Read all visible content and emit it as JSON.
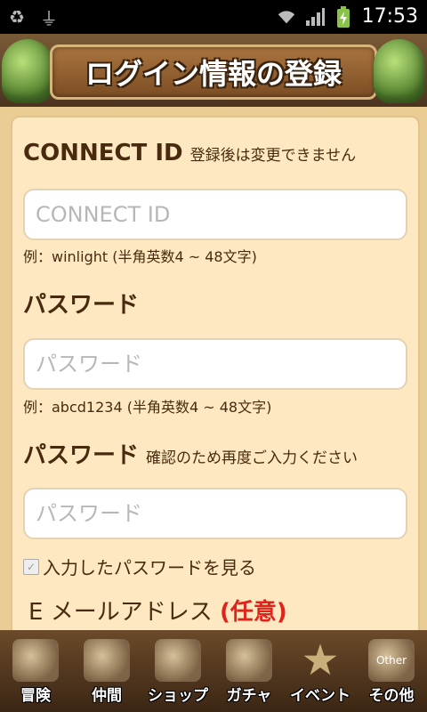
{
  "status_bar": {
    "time": "17:53",
    "left_icons": [
      "recycle-icon",
      "usb-icon"
    ],
    "right_icons": [
      "wifi-icon",
      "signal-icon",
      "battery-charging-icon"
    ]
  },
  "header": {
    "title": "ログイン情報の登録"
  },
  "form": {
    "connect_id": {
      "label": "CONNECT ID",
      "note": "登録後は変更できません",
      "placeholder": "CONNECT ID",
      "hint": "例：winlight (半角英数4 ~ 48文字)"
    },
    "password": {
      "label": "パスワード",
      "placeholder": "パスワード",
      "hint": "例：abcd1234 (半角英数4 ~ 48文字)"
    },
    "password_confirm": {
      "label": "パスワード",
      "note": "確認のため再度ご入力ください",
      "placeholder": "パスワード"
    },
    "show_password": {
      "label": "入力したパスワードを見る",
      "checked": true
    },
    "email": {
      "label": "E メールアドレス",
      "optional": "(任意)"
    }
  },
  "bottom_nav": {
    "items": [
      {
        "label": "冒険",
        "icon": "map-icon"
      },
      {
        "label": "仲間",
        "icon": "party-icon"
      },
      {
        "label": "ショップ",
        "icon": "shop-icon"
      },
      {
        "label": "ガチャ",
        "icon": "gacha-icon"
      },
      {
        "label": "イベント",
        "icon": "star-icon"
      },
      {
        "label": "その他",
        "icon": "other-icon",
        "icon_text": "Other"
      }
    ]
  },
  "colors": {
    "text_brown": "#4a2a0e",
    "accent_red": "#e0241b",
    "panel_bg": "#fde8c2"
  }
}
